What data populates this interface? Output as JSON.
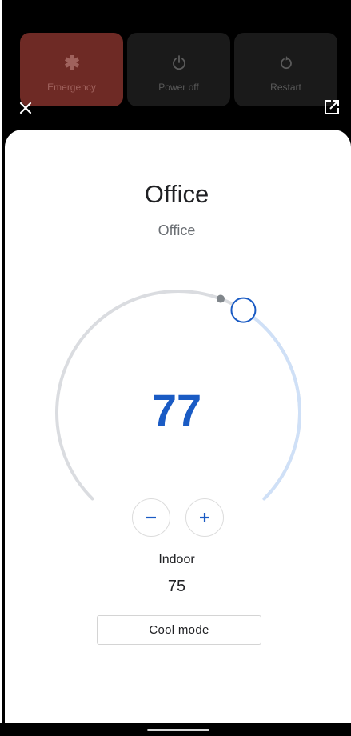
{
  "power_menu": {
    "emergency_label": "Emergency",
    "emergency_icon": "asterisk-icon",
    "power_off_label": "Power off",
    "power_off_icon": "power-icon",
    "restart_label": "Restart",
    "restart_icon": "restart-icon"
  },
  "header": {
    "close_icon": "close-icon",
    "open_external_icon": "open-external-icon"
  },
  "device": {
    "name": "Office",
    "room": "Office"
  },
  "thermostat": {
    "setpoint": "77",
    "setpoint_level": 0.62,
    "indoor_label": "Indoor",
    "indoor_value": "75",
    "mode_label": "Cool mode",
    "accent_color": "#1a5bc4",
    "track_color": "#dadce0",
    "active_track_color": "#cfe0f7"
  }
}
